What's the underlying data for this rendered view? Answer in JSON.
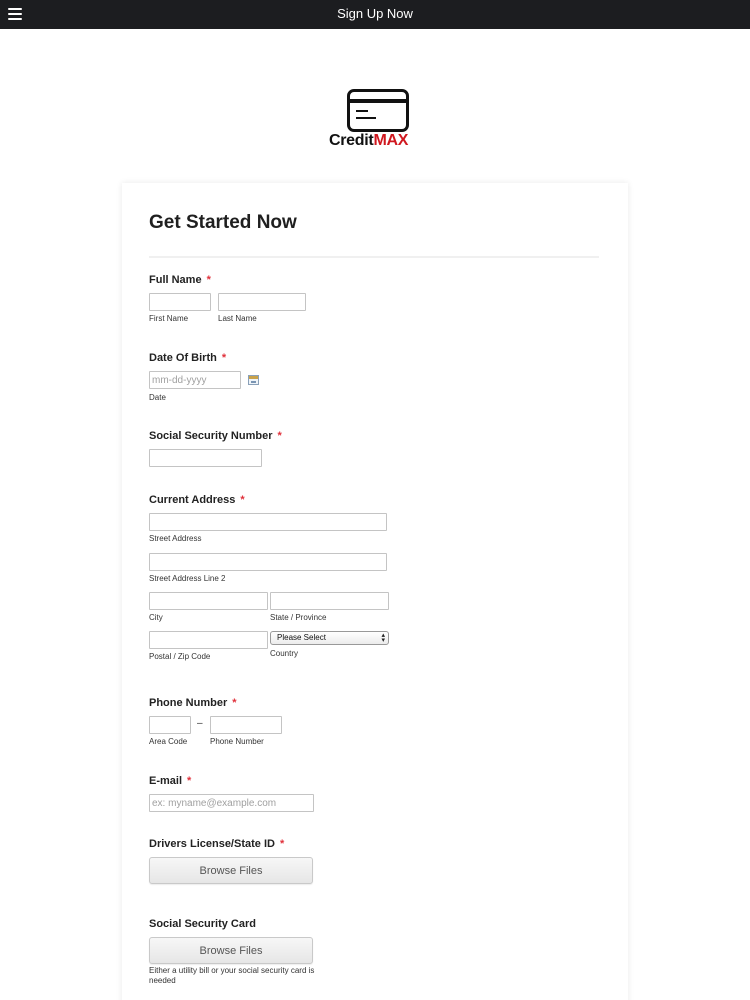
{
  "topbar": {
    "menu_icon": "hamburger-menu-icon",
    "title": "Sign Up Now"
  },
  "logo": {
    "icon": "credit-card-icon",
    "text_part1": "Credit",
    "text_part2": "MAX",
    "colors": {
      "dark": "#111111",
      "accent": "#d0181f"
    }
  },
  "form": {
    "title": "Get Started Now",
    "required_mark": "*",
    "full_name": {
      "label": "Full Name",
      "first_sub": "First Name",
      "last_sub": "Last Name",
      "first_value": "",
      "last_value": ""
    },
    "dob": {
      "label": "Date Of Birth",
      "placeholder": "mm-dd-yyyy",
      "sub": "Date",
      "calendar_icon": "calendar-icon"
    },
    "ssn": {
      "label": "Social Security Number",
      "value": ""
    },
    "address": {
      "label": "Current Address",
      "street_sub": "Street Address",
      "street2_sub": "Street Address Line 2",
      "city_sub": "City",
      "state_sub": "State / Province",
      "postal_sub": "Postal / Zip Code",
      "country_sub": "Country",
      "country_selected": "Please Select"
    },
    "phone": {
      "label": "Phone Number",
      "separator": "–",
      "area_sub": "Area Code",
      "number_sub": "Phone Number"
    },
    "email": {
      "label": "E-mail",
      "placeholder": "ex: myname@example.com"
    },
    "license": {
      "label": "Drivers License/State ID",
      "button": "Browse Files"
    },
    "ss_card": {
      "label": "Social Security Card",
      "button": "Browse Files",
      "helper": "Either a utility bill or your social security card is needed"
    },
    "colors": {
      "required": "#e0303a",
      "topbar": "#1c1d20"
    }
  }
}
